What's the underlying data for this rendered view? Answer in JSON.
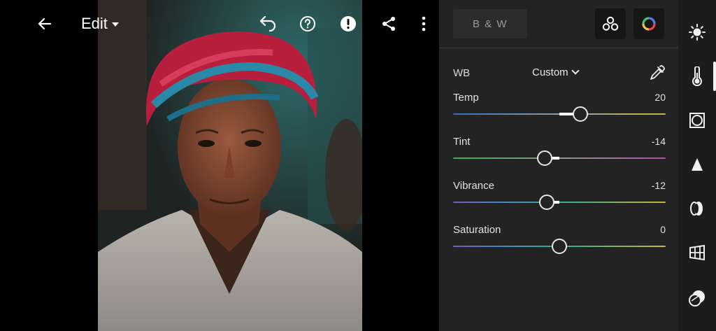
{
  "toolbar": {
    "edit_label": "Edit",
    "icons": [
      "back-arrow-icon",
      "undo-icon",
      "help-icon",
      "alert-icon",
      "share-icon",
      "more-vertical-icon"
    ]
  },
  "panel": {
    "bw_label": "B & W",
    "profile_icon": "profiles-icon",
    "color_icon": "color-wheel-icon",
    "wb": {
      "label": "WB",
      "value": "Custom"
    },
    "sliders": [
      {
        "label": "Temp",
        "value": "20",
        "fraction": 0.6
      },
      {
        "label": "Tint",
        "value": "-14",
        "fraction": 0.43
      },
      {
        "label": "Vibrance",
        "value": "-12",
        "fraction": 0.44
      },
      {
        "label": "Saturation",
        "value": "0",
        "fraction": 0.5
      }
    ]
  },
  "rail": {
    "items": [
      "light-icon",
      "color-thermometer-icon",
      "effects-icon",
      "detail-icon",
      "optics-icon",
      "geometry-icon",
      "healing-icon"
    ],
    "active_index": 1
  },
  "colors": {
    "panel_bg": "#232323",
    "rail_bg": "#1c1c1c",
    "accent": "#ffffff"
  }
}
